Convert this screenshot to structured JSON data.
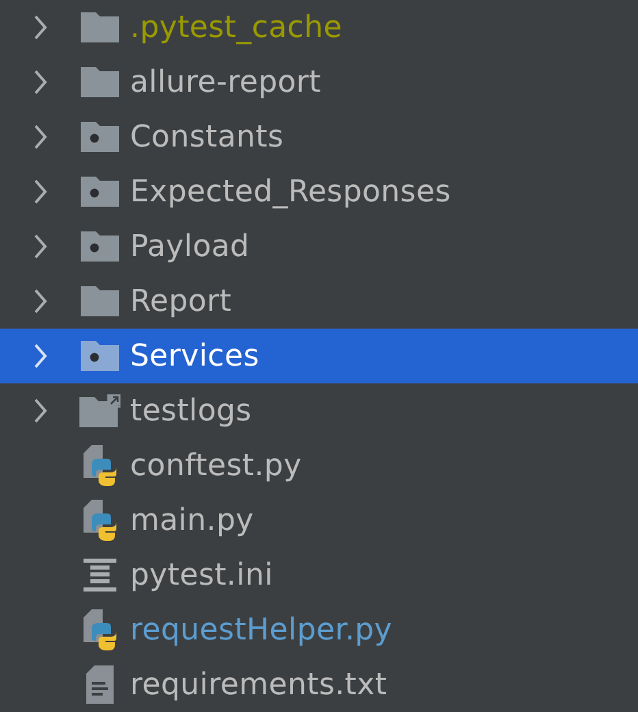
{
  "project_tree": {
    "items": [
      {
        "label": ".pytest_cache",
        "kind": "folder",
        "color": "#9a9a00",
        "expanded": false,
        "selected": false
      },
      {
        "label": "allure-report",
        "kind": "folder",
        "color": "#bbbbbb",
        "expanded": false,
        "selected": false
      },
      {
        "label": "Constants",
        "kind": "package",
        "color": "#bbbbbb",
        "expanded": false,
        "selected": false
      },
      {
        "label": "Expected_Responses",
        "kind": "package",
        "color": "#bbbbbb",
        "expanded": false,
        "selected": false
      },
      {
        "label": "Payload",
        "kind": "package",
        "color": "#bbbbbb",
        "expanded": false,
        "selected": false
      },
      {
        "label": "Report",
        "kind": "folder",
        "color": "#bbbbbb",
        "expanded": false,
        "selected": false
      },
      {
        "label": "Services",
        "kind": "package",
        "color": "#ffffff",
        "expanded": false,
        "selected": true
      },
      {
        "label": "testlogs",
        "kind": "symlink",
        "color": "#bbbbbb",
        "expanded": false,
        "selected": false
      },
      {
        "label": "conftest.py",
        "kind": "python",
        "color": "#bbbbbb",
        "selected": false
      },
      {
        "label": "main.py",
        "kind": "python",
        "color": "#bbbbbb",
        "selected": false
      },
      {
        "label": "pytest.ini",
        "kind": "ini",
        "color": "#bbbbbb",
        "selected": false
      },
      {
        "label": "requestHelper.py",
        "kind": "python",
        "color": "#5c9dd0",
        "selected": false
      },
      {
        "label": "requirements.txt",
        "kind": "text",
        "color": "#bbbbbb",
        "selected": false
      }
    ]
  }
}
